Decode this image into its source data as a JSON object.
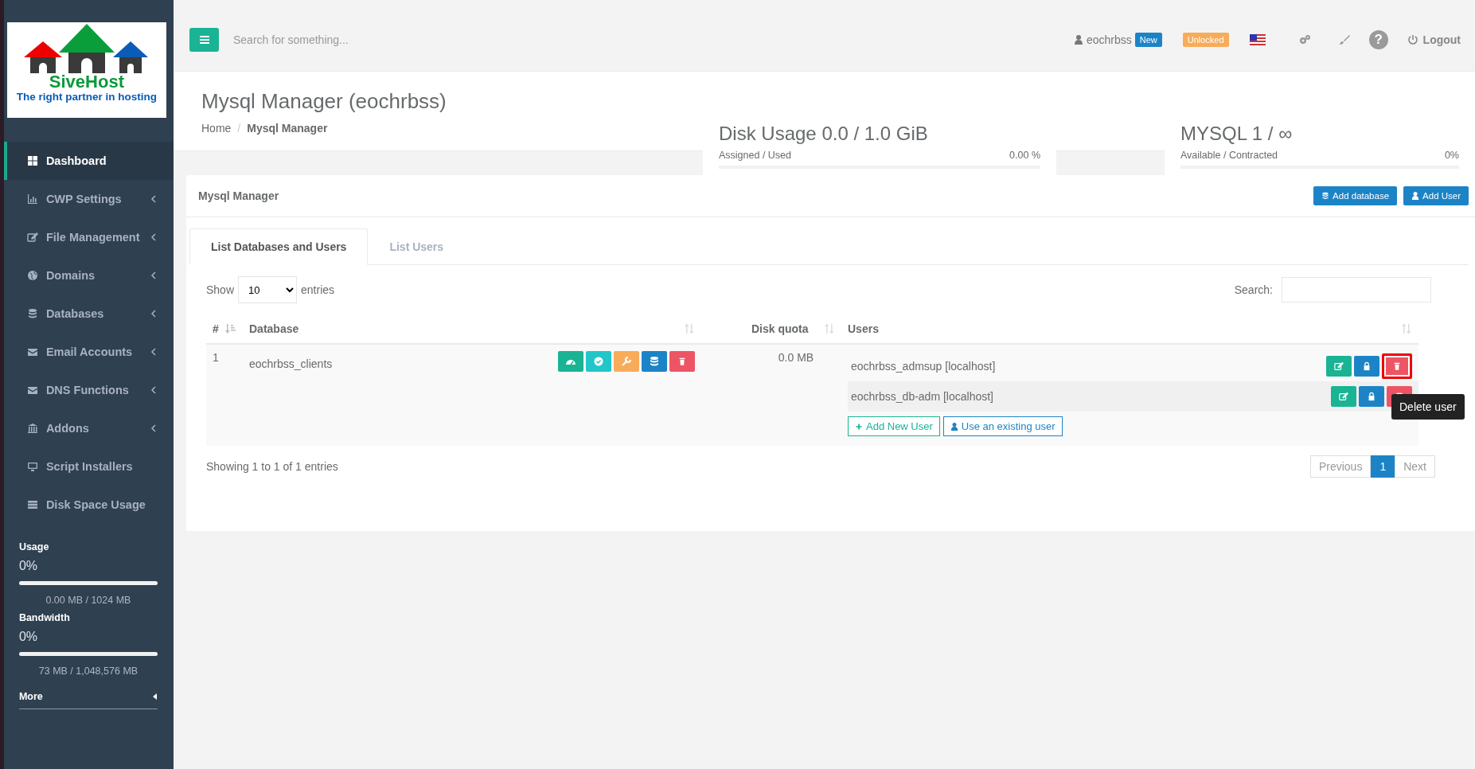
{
  "logo": {
    "name": "SiveHost",
    "tagline": "The right partner in hosting"
  },
  "sidebar": {
    "items": [
      {
        "label": "Dashboard",
        "has_submenu": false,
        "selected": true
      },
      {
        "label": "CWP Settings",
        "has_submenu": true,
        "selected": false
      },
      {
        "label": "File Management",
        "has_submenu": true,
        "selected": false
      },
      {
        "label": "Domains",
        "has_submenu": true,
        "selected": false
      },
      {
        "label": "Databases",
        "has_submenu": true,
        "selected": false
      },
      {
        "label": "Email Accounts",
        "has_submenu": true,
        "selected": false
      },
      {
        "label": "DNS Functions",
        "has_submenu": true,
        "selected": false
      },
      {
        "label": "Addons",
        "has_submenu": true,
        "selected": false
      },
      {
        "label": "Script Installers",
        "has_submenu": false,
        "selected": false
      },
      {
        "label": "Disk Space Usage",
        "has_submenu": false,
        "selected": false
      }
    ],
    "meters": [
      {
        "title": "Usage",
        "percent": "0%",
        "level": 0,
        "detail": "0.00 MB / 1024 MB"
      },
      {
        "title": "Bandwidth",
        "percent": "0%",
        "level": 0,
        "detail": "73 MB / 1,048,576 MB"
      }
    ],
    "more": "More"
  },
  "header": {
    "search": {
      "placeholder": "Search for something..."
    },
    "user": "eochrbss",
    "new_badge": "New",
    "status_badge": "Unlocked",
    "help": "?",
    "logout": "Logout"
  },
  "page": {
    "title": "Mysql Manager (eochrbss)",
    "breadcrumb": [
      {
        "label": "Home",
        "current": false
      },
      {
        "label": "Mysql Manager",
        "current": true
      }
    ],
    "separator": "/"
  },
  "stats": [
    {
      "title": "Disk Usage 0.0 / 1.0 GiB",
      "caption": "Assigned / Used",
      "value": "0.00 %",
      "level": 0
    },
    {
      "title": "MYSQL 1 / ∞",
      "caption": "Available / Contracted",
      "value": "0%",
      "level": 0
    }
  ],
  "panel": {
    "title": "Mysql Manager",
    "buttons": [
      {
        "label": "Add database",
        "kind": "database"
      },
      {
        "label": "Add User",
        "kind": "user"
      }
    ],
    "tabs": [
      {
        "label": "List Databases and Users",
        "selected": true
      },
      {
        "label": "List Users",
        "selected": false
      }
    ],
    "length": {
      "before": "Show",
      "value": "10",
      "after": "entries"
    },
    "search_label": "Search:",
    "table": {
      "columns": [
        {
          "label": "#"
        },
        {
          "label": "Database"
        },
        {
          "label": "Disk quota"
        },
        {
          "label": "Users"
        }
      ],
      "rows": [
        {
          "number": "1",
          "database": "eochrbss_clients",
          "disk_quota": "0.0 MB",
          "users": [
            {
              "name": "eochrbss_admsup [localhost]",
              "delete_highlighted": true
            },
            {
              "name": "eochrbss_db-adm [localhost]",
              "delete_highlighted": false
            }
          ],
          "add_user": "Add New User",
          "existing_user": "Use an existing user"
        }
      ]
    },
    "info": "Showing 1 to 1 of 1 entries",
    "pagination": {
      "previous": "Previous",
      "pages": [
        {
          "label": "1",
          "selected": true
        }
      ],
      "next": "Next"
    }
  },
  "tooltip": {
    "text": "Delete user"
  }
}
